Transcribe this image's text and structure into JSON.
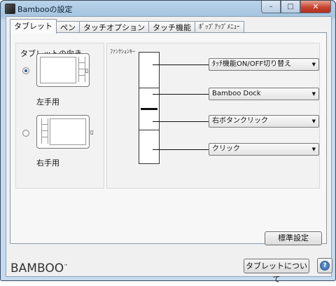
{
  "window": {
    "title": "Bambooの設定",
    "minimize": "–",
    "maximize": "□",
    "close": "✕"
  },
  "tabs": [
    {
      "label": "タブレット",
      "active": true
    },
    {
      "label": "ペン"
    },
    {
      "label": "タッチオプション"
    },
    {
      "label": "タッチ機能"
    },
    {
      "label": "ﾎﾟｯﾌﾟｱｯﾌﾟﾒﾆｭｰ"
    }
  ],
  "orientation": {
    "title": "タブレットの向き",
    "left_label": "左手用",
    "right_label": "右手用",
    "selected": "left"
  },
  "function_keys": {
    "title": "ﾌｧﾝｸｼｮﾝｷｰ",
    "dropdowns": [
      "ﾀｯﾁ機能ON/OFF切り替え",
      "Bamboo Dock",
      "右ボタンクリック",
      "クリック"
    ]
  },
  "buttons": {
    "default": "標準設定",
    "about": "タブレットについて",
    "help": "?"
  },
  "brand": {
    "logo": "BAMBOO",
    "trademark": "™"
  }
}
